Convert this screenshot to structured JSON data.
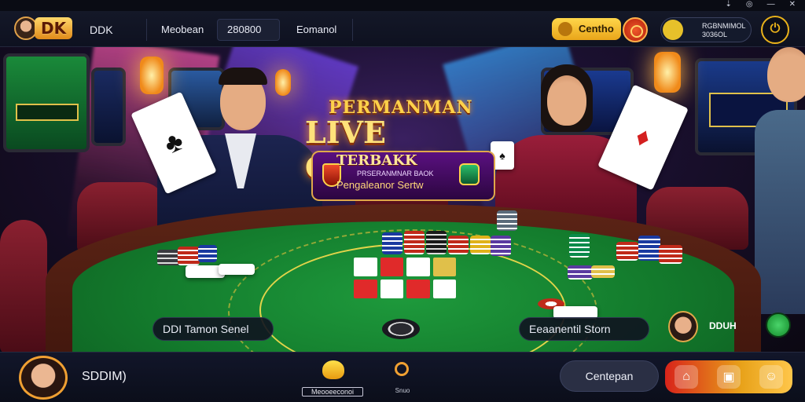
{
  "header": {
    "brand_logo": "DK",
    "brand_name": "DDK",
    "field_left": "Meobean",
    "field_mid": "280800",
    "field_right": "Eomanol",
    "coin_button": "Centho",
    "user_pill_line1": "RGBNMIMOL",
    "user_pill_line2": "3036OL",
    "power_icon": "power-icon",
    "window_controls": [
      "⇣",
      "◎",
      "—",
      "✕"
    ]
  },
  "hero": {
    "line1": "PERMANMAN",
    "line2": "LIVE CAAINQ",
    "line3": "TERBAKK",
    "line4": "PRSERANMNAR BAOK",
    "line5": "Pengaleanor Sertw"
  },
  "table": {
    "left_label": "DDI Tamon Senel",
    "right_label": "Eeaanentil Storn",
    "dealer_name": "DDUH",
    "cards": {
      "left_card": "♣",
      "right_card": "♦"
    }
  },
  "bottom": {
    "user_name": "SDDIM)",
    "gift_label": "Meooeeconoi",
    "search_label": "Snuo",
    "action_button": "Centepan"
  },
  "colors": {
    "accent_gold": "#f0a032",
    "felt_green": "#137a2c",
    "rim_brown": "#5c2416",
    "action_red": "#d8231a"
  }
}
